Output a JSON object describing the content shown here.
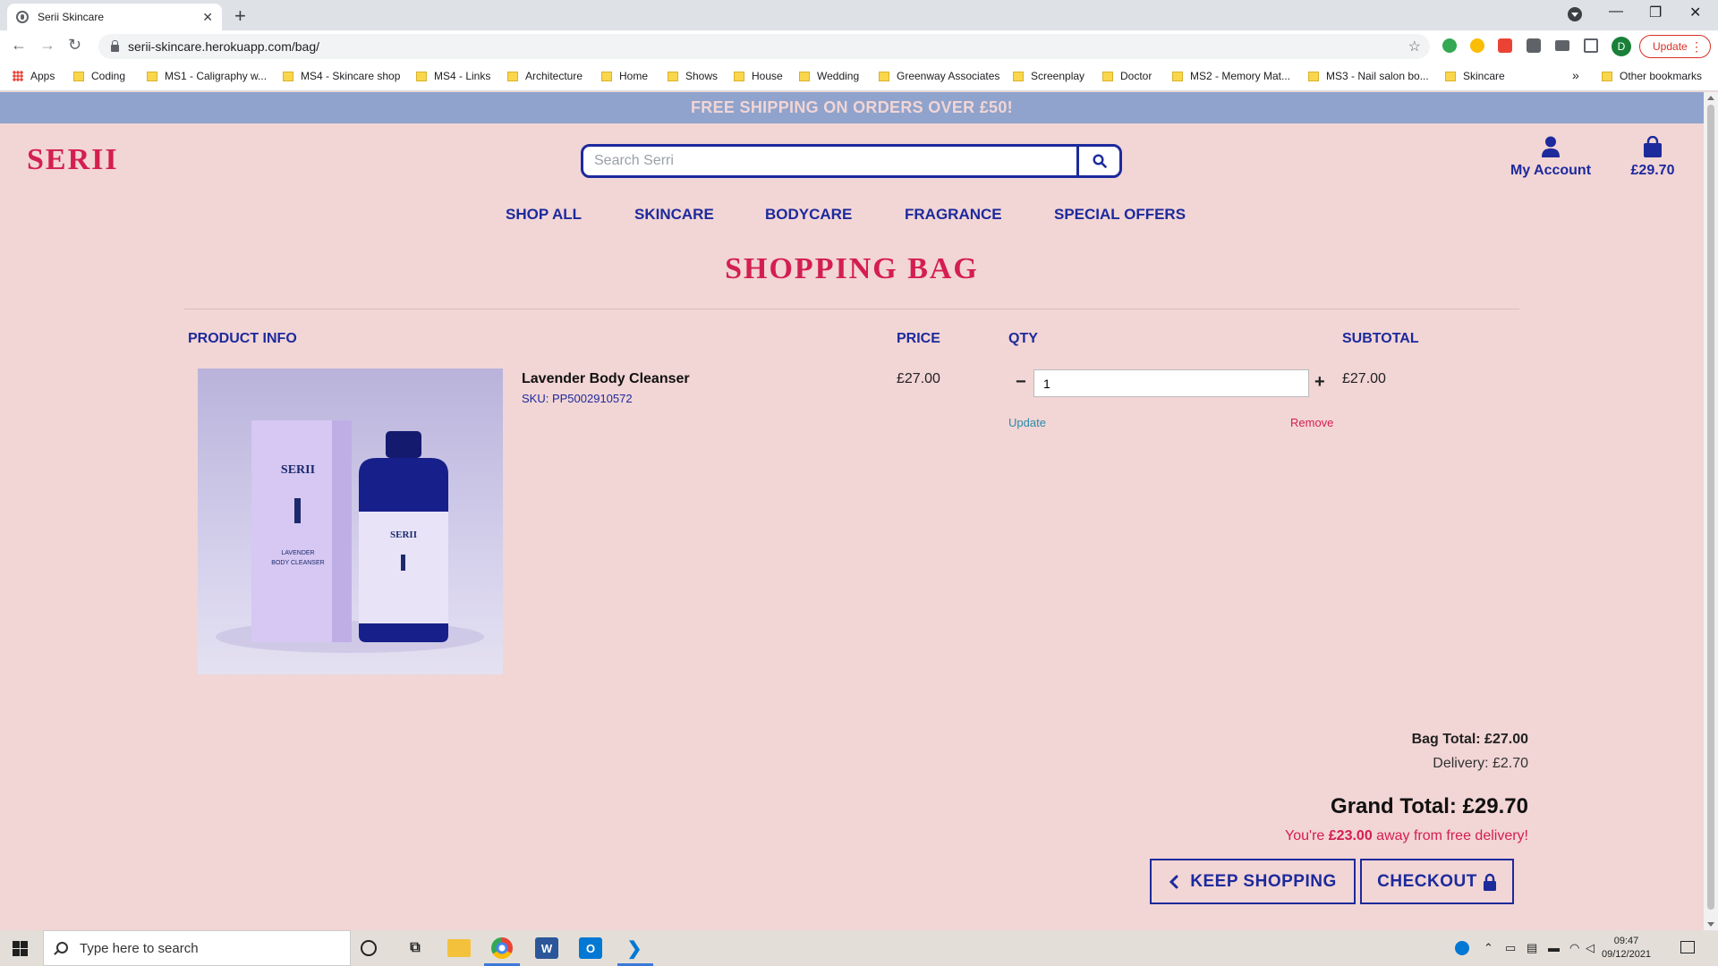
{
  "browser": {
    "tab_title": "Serii Skincare",
    "url": "serii-skincare.herokuapp.com/bag/",
    "update_label": "Update",
    "profile_initial": "D",
    "bookmarks": [
      "Apps",
      "Coding",
      "MS1 - Caligraphy w...",
      "MS4 - Skincare shop",
      "MS4 - Links",
      "Architecture",
      "Home",
      "Shows",
      "House",
      "Wedding",
      "Greenway Associates",
      "Screenplay",
      "Doctor",
      "MS2 - Memory Mat...",
      "MS3 - Nail salon bo...",
      "Skincare"
    ],
    "other_bookmarks": "Other bookmarks"
  },
  "site": {
    "banner": "FREE SHIPPING ON ORDERS OVER £50!",
    "logo": "SERII",
    "search_placeholder": "Search Serri",
    "account_label": "My Account",
    "bag_total": "£29.70",
    "nav": [
      "SHOP ALL",
      "SKINCARE",
      "BODYCARE",
      "FRAGRANCE",
      "SPECIAL OFFERS"
    ]
  },
  "bag": {
    "title": "SHOPPING BAG",
    "columns": {
      "product": "PRODUCT INFO",
      "price": "PRICE",
      "qty": "QTY",
      "subtotal": "SUBTOTAL"
    },
    "item": {
      "name": "Lavender Body Cleanser",
      "sku": "SKU: PP5002910572",
      "price": "£27.00",
      "qty": "1",
      "subtotal": "£27.00",
      "update_label": "Update",
      "remove_label": "Remove",
      "image_text": {
        "brand": "SERII",
        "line1": "LAVENDER",
        "line2": "BODY CLEANSER"
      }
    },
    "bag_total": "Bag Total: £27.00",
    "delivery": "Delivery: £2.70",
    "grand_total": "Grand Total: £29.70",
    "free_delivery_prefix": "You're ",
    "free_delivery_amount": "£23.00",
    "free_delivery_suffix": " away from free delivery!",
    "keep_shopping": "KEEP SHOPPING",
    "checkout": "CHECKOUT"
  },
  "taskbar": {
    "search_placeholder": "Type here to search",
    "time": "09:47",
    "date": "09/12/2021"
  },
  "colors": {
    "page_bg": "#f2d5d5",
    "navy": "#1c2a9c",
    "crimson": "#d31f4f",
    "banner_bg": "#8fa3cc"
  }
}
